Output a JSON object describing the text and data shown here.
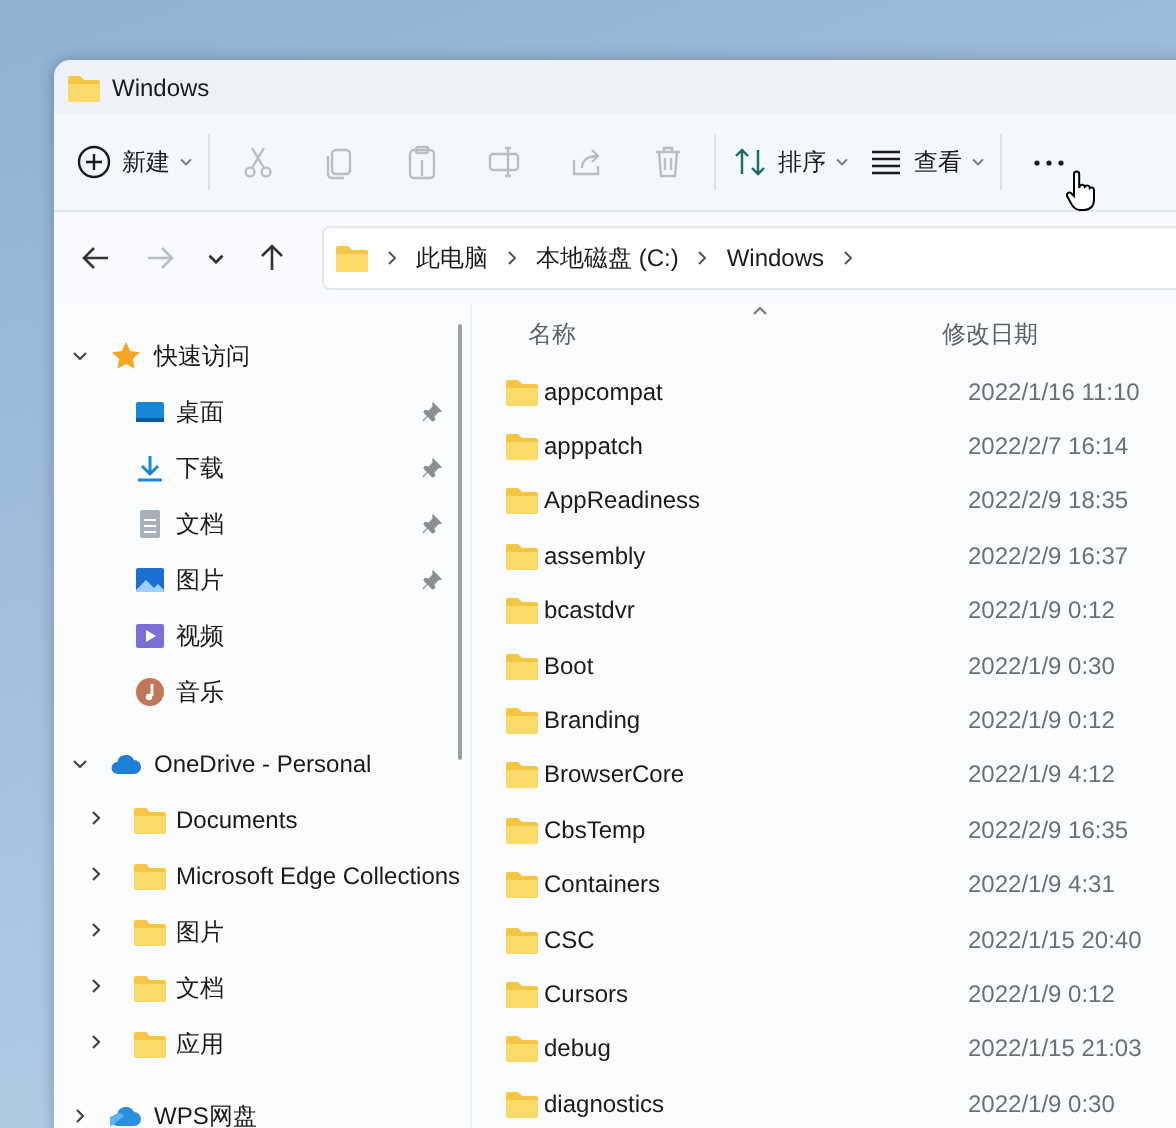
{
  "window": {
    "title": "Windows"
  },
  "toolbar": {
    "items": [
      {
        "kind": "new",
        "label": "新建",
        "disabled": false,
        "caret": true
      },
      {
        "kind": "cut",
        "disabled": true
      },
      {
        "kind": "copy",
        "disabled": true
      },
      {
        "kind": "paste",
        "disabled": true
      },
      {
        "kind": "rename",
        "disabled": true
      },
      {
        "kind": "share",
        "disabled": true
      },
      {
        "kind": "delete",
        "disabled": true
      },
      {
        "kind": "sort",
        "label": "排序",
        "disabled": false,
        "caret": true
      },
      {
        "kind": "view",
        "label": "查看",
        "disabled": false,
        "caret": true
      },
      {
        "kind": "more",
        "disabled": false
      }
    ]
  },
  "navigation": [
    {
      "kind": "back",
      "disabled": false
    },
    {
      "kind": "forward",
      "disabled": true
    },
    {
      "kind": "recent",
      "disabled": false
    },
    {
      "kind": "up",
      "disabled": false
    }
  ],
  "address": {
    "segments": [
      "此电脑",
      "本地磁盘 (C:)",
      "Windows"
    ]
  },
  "sidebar": {
    "sections": [
      {
        "label": "快速访问",
        "kind": "star",
        "expanded": true,
        "children": [
          {
            "label": "桌面",
            "kind": "desktop",
            "pinned": true
          },
          {
            "label": "下载",
            "kind": "download",
            "pinned": true
          },
          {
            "label": "文档",
            "kind": "document",
            "pinned": true
          },
          {
            "label": "图片",
            "kind": "picture",
            "pinned": true
          },
          {
            "label": "视频",
            "kind": "video",
            "pinned": false
          },
          {
            "label": "音乐",
            "kind": "music",
            "pinned": false
          }
        ]
      },
      {
        "label": "OneDrive - Personal",
        "kind": "cloud",
        "expanded": true,
        "children": [
          {
            "label": "Documents",
            "kind": "folder",
            "expanded": false
          },
          {
            "label": "Microsoft Edge Collections",
            "kind": "folder",
            "expanded": false
          },
          {
            "label": "图片",
            "kind": "folder",
            "expanded": false
          },
          {
            "label": "文档",
            "kind": "folder",
            "expanded": false
          },
          {
            "label": "应用",
            "kind": "folder",
            "expanded": false
          }
        ]
      },
      {
        "label": "WPS网盘",
        "kind": "wps",
        "expanded": false
      }
    ]
  },
  "file_list": {
    "columns": [
      {
        "label": "名称",
        "sorted": true
      },
      {
        "label": "修改日期",
        "sorted": false
      }
    ],
    "rows": [
      {
        "name": "appcompat",
        "modified": "2022/1/16 11:10"
      },
      {
        "name": "apppatch",
        "modified": "2022/2/7 16:14"
      },
      {
        "name": "AppReadiness",
        "modified": "2022/2/9 18:35"
      },
      {
        "name": "assembly",
        "modified": "2022/2/9 16:37"
      },
      {
        "name": "bcastdvr",
        "modified": "2022/1/9 0:12"
      },
      {
        "name": "Boot",
        "modified": "2022/1/9 0:30"
      },
      {
        "name": "Branding",
        "modified": "2022/1/9 0:12"
      },
      {
        "name": "BrowserCore",
        "modified": "2022/1/9 4:12"
      },
      {
        "name": "CbsTemp",
        "modified": "2022/2/9 16:35"
      },
      {
        "name": "Containers",
        "modified": "2022/1/9 4:31"
      },
      {
        "name": "CSC",
        "modified": "2022/1/15 20:40"
      },
      {
        "name": "Cursors",
        "modified": "2022/1/9 0:12"
      },
      {
        "name": "debug",
        "modified": "2022/1/15 21:03"
      },
      {
        "name": "diagnostics",
        "modified": "2022/1/9 0:30"
      }
    ]
  }
}
